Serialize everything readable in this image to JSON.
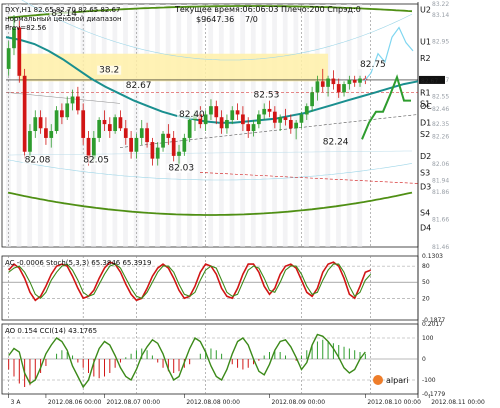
{
  "header": {
    "symbol_line": "DXY,H1  82.65 82.70 82.65 82.67",
    "server_time": "Текущее время:06:06:03 Плечо:200 Спрэд:0",
    "account_value": "$9647.36",
    "ratio": "7/0",
    "corner_value": "83.14",
    "indicator_name": "нормальный ценовой диапазон",
    "indicator_sub": "Prev=82.56"
  },
  "colors": {
    "bull_candle": "#2e9c2e",
    "bear_candle": "#d11515",
    "teal_line": "#1a8f8f",
    "envelope": "#4f8f14",
    "forecast": "#7fd6f0",
    "pivot_bg": "#fff0a8",
    "stoch_main": "#d11515",
    "stoch_signal": "#3c8a1a",
    "cci": "#3c8a1a",
    "ao_bar": "#d11515"
  },
  "chart_data": [
    {
      "type": "candlestick",
      "title": "DXY,H1",
      "ylim": [
        81.46,
        83.22
      ],
      "y_ticks": [
        {
          "v": 83.22,
          "l": "83.22"
        },
        {
          "v": 83.14,
          "l": "83.14"
        },
        {
          "v": 82.95,
          "l": "82.95"
        },
        {
          "v": 82.67,
          "l": "82.67"
        },
        {
          "v": 82.55,
          "l": "82.55"
        },
        {
          "v": 82.46,
          "l": "82.46"
        },
        {
          "v": 82.35,
          "l": "82.35"
        },
        {
          "v": 82.26,
          "l": "82.26"
        },
        {
          "v": 82.06,
          "l": "82.06"
        },
        {
          "v": 81.94,
          "l": "81.94"
        },
        {
          "v": 81.86,
          "l": "81.86"
        },
        {
          "v": 81.66,
          "l": "81.66"
        },
        {
          "v": 81.46,
          "l": "81.46"
        }
      ],
      "price_labels": [
        {
          "t": "83.14",
          "x": 8,
          "v": 83.14
        },
        {
          "t": "38.2",
          "x": 17,
          "v": 82.73
        },
        {
          "t": "82.67",
          "x": 22,
          "v": 82.62
        },
        {
          "t": "82.40",
          "x": 32,
          "v": 82.41
        },
        {
          "t": "82.53",
          "x": 46,
          "v": 82.55
        },
        {
          "t": "82.75",
          "x": 66,
          "v": 82.77
        },
        {
          "t": "82.24",
          "x": 59,
          "v": 82.21
        },
        {
          "t": "82.08",
          "x": 3,
          "v": 82.08
        },
        {
          "t": "82.05",
          "x": 14,
          "v": 82.08
        },
        {
          "t": "82.03",
          "x": 30,
          "v": 82.02
        }
      ],
      "levels": [
        {
          "name": "U2",
          "v": 83.18
        },
        {
          "name": "U1",
          "v": 82.95
        },
        {
          "name": "R2",
          "v": 82.83
        },
        {
          "name": "LB",
          "v": 82.67
        },
        {
          "name": "R1",
          "v": 82.58
        },
        {
          "name": "S1",
          "v": 82.5
        },
        {
          "name": "OC",
          "v": 82.48
        },
        {
          "name": "D1",
          "v": 82.36
        },
        {
          "name": "S2",
          "v": 82.28
        },
        {
          "name": "D2",
          "v": 82.12
        },
        {
          "name": "S3",
          "v": 82.0
        },
        {
          "name": "D3",
          "v": 81.9
        },
        {
          "name": "S4",
          "v": 81.71
        },
        {
          "name": "D4",
          "v": 81.6
        }
      ],
      "session_markers": [
        0,
        14,
        24,
        37,
        55,
        68
      ],
      "x_ticks": [
        {
          "x": 0,
          "l": "3 A"
        },
        {
          "x": 7,
          "l": "2012.08.06 00:00"
        },
        {
          "x": 18,
          "l": "2012.08.07 00:00"
        },
        {
          "x": 33,
          "l": "2012.08.08 00:00"
        },
        {
          "x": 49,
          "l": "2012.08.09 00:00"
        },
        {
          "x": 67,
          "l": "2012.08.10 00:00"
        },
        {
          "x": 79,
          "l": "2012.08.11 00:00"
        }
      ],
      "candles": [
        [
          82.75,
          82.95,
          82.7,
          82.9
        ],
        [
          82.9,
          83.14,
          82.85,
          83.05
        ],
        [
          83.05,
          83.1,
          82.65,
          82.7
        ],
        [
          82.7,
          82.75,
          82.1,
          82.15
        ],
        [
          82.15,
          82.35,
          82.08,
          82.3
        ],
        [
          82.3,
          82.45,
          82.25,
          82.4
        ],
        [
          82.4,
          82.45,
          82.28,
          82.32
        ],
        [
          82.32,
          82.4,
          82.2,
          82.25
        ],
        [
          82.25,
          82.35,
          82.18,
          82.3
        ],
        [
          82.3,
          82.48,
          82.28,
          82.45
        ],
        [
          82.45,
          82.5,
          82.35,
          82.4
        ],
        [
          82.4,
          82.55,
          82.38,
          82.5
        ],
        [
          82.5,
          82.6,
          82.45,
          82.55
        ],
        [
          82.55,
          82.62,
          82.42,
          82.45
        ],
        [
          82.45,
          82.5,
          82.2,
          82.25
        ],
        [
          82.25,
          82.3,
          82.05,
          82.1
        ],
        [
          82.1,
          82.3,
          82.08,
          82.25
        ],
        [
          82.25,
          82.4,
          82.22,
          82.38
        ],
        [
          82.38,
          82.45,
          82.3,
          82.35
        ],
        [
          82.35,
          82.4,
          82.25,
          82.3
        ],
        [
          82.3,
          82.42,
          82.28,
          82.4
        ],
        [
          82.4,
          82.45,
          82.3,
          82.32
        ],
        [
          82.32,
          82.38,
          82.2,
          82.25
        ],
        [
          82.25,
          82.3,
          82.1,
          82.15
        ],
        [
          82.15,
          82.28,
          82.1,
          82.25
        ],
        [
          82.25,
          82.38,
          82.2,
          82.32
        ],
        [
          82.32,
          82.36,
          82.18,
          82.22
        ],
        [
          82.22,
          82.25,
          82.05,
          82.1
        ],
        [
          82.1,
          82.22,
          82.05,
          82.18
        ],
        [
          82.18,
          82.3,
          82.15,
          82.28
        ],
        [
          82.28,
          82.35,
          82.2,
          82.25
        ],
        [
          82.25,
          82.3,
          82.08,
          82.12
        ],
        [
          82.12,
          82.2,
          82.03,
          82.15
        ],
        [
          82.15,
          82.28,
          82.12,
          82.25
        ],
        [
          82.25,
          82.4,
          82.22,
          82.38
        ],
        [
          82.38,
          82.45,
          82.3,
          82.42
        ],
        [
          82.42,
          82.48,
          82.32,
          82.35
        ],
        [
          82.35,
          82.45,
          82.3,
          82.42
        ],
        [
          82.42,
          82.53,
          82.38,
          82.48
        ],
        [
          82.48,
          82.52,
          82.35,
          82.4
        ],
        [
          82.4,
          82.45,
          82.28,
          82.32
        ],
        [
          82.32,
          82.42,
          82.28,
          82.38
        ],
        [
          82.38,
          82.48,
          82.35,
          82.45
        ],
        [
          82.45,
          82.5,
          82.38,
          82.42
        ],
        [
          82.42,
          82.48,
          82.3,
          82.35
        ],
        [
          82.35,
          82.4,
          82.25,
          82.3
        ],
        [
          82.3,
          82.38,
          82.26,
          82.35
        ],
        [
          82.35,
          82.45,
          82.32,
          82.42
        ],
        [
          82.42,
          82.5,
          82.38,
          82.46
        ],
        [
          82.46,
          82.52,
          82.4,
          82.44
        ],
        [
          82.44,
          82.48,
          82.32,
          82.36
        ],
        [
          82.36,
          82.42,
          82.3,
          82.4
        ],
        [
          82.4,
          82.46,
          82.34,
          82.38
        ],
        [
          82.38,
          82.42,
          82.28,
          82.32
        ],
        [
          82.32,
          82.38,
          82.24,
          82.36
        ],
        [
          82.36,
          82.44,
          82.32,
          82.42
        ],
        [
          82.42,
          82.5,
          82.38,
          82.48
        ],
        [
          82.48,
          82.62,
          82.44,
          82.58
        ],
        [
          82.58,
          82.7,
          82.52,
          82.66
        ],
        [
          82.66,
          82.75,
          82.58,
          82.62
        ],
        [
          82.62,
          82.7,
          82.55,
          82.68
        ],
        [
          82.68,
          82.74,
          82.6,
          82.64
        ],
        [
          82.64,
          82.68,
          82.54,
          82.58
        ],
        [
          82.58,
          82.66,
          82.55,
          82.64
        ],
        [
          82.64,
          82.7,
          82.6,
          82.67
        ],
        [
          82.67,
          82.7,
          82.62,
          82.65
        ],
        [
          82.65,
          82.7,
          82.62,
          82.68
        ],
        [
          82.68,
          82.7,
          82.64,
          82.67
        ]
      ],
      "teal_ma": [
        82.98,
        82.96,
        82.93,
        82.88,
        82.82,
        82.75,
        82.68,
        82.62,
        82.57,
        82.52,
        82.48,
        82.44,
        82.41,
        82.39,
        82.37,
        82.36,
        82.36,
        82.37,
        82.38,
        82.39,
        82.41,
        82.43,
        82.46,
        82.49,
        82.52,
        82.55,
        82.58,
        82.61,
        82.64,
        82.66
      ],
      "forecast": [
        82.66,
        82.72,
        82.86,
        82.8,
        82.98,
        83.05,
        82.94,
        82.88
      ]
    },
    {
      "type": "line",
      "title": "AC -0.0006 Stoch(5,3,3) 65.3846 65.3919",
      "ylim": [
        -0.1877,
        0.1303
      ],
      "y_ticks": [
        {
          "v": 0.1303,
          "l": "0.1303"
        },
        {
          "v": 0.08,
          "l": "80"
        },
        {
          "v": 0.0,
          "l": "50"
        },
        {
          "v": -0.08,
          "l": "20"
        },
        {
          "v": -0.1877,
          "l": "-0.1877"
        }
      ],
      "series": [
        {
          "name": "Stoch(5,3,3)",
          "values": [
            0.06,
            0.09,
            0.07,
            0.02,
            -0.05,
            -0.09,
            -0.07,
            -0.02,
            0.04,
            0.08,
            0.09,
            0.08,
            0.03,
            -0.03,
            -0.08,
            -0.07,
            -0.04,
            0.02,
            0.07,
            0.1,
            0.09,
            0.05,
            -0.01,
            -0.06,
            -0.09,
            -0.08,
            -0.03,
            0.03,
            0.07,
            0.09,
            0.07,
            0.02,
            -0.04,
            -0.08,
            -0.07,
            -0.02,
            0.05,
            0.09,
            0.08,
            0.04,
            -0.03,
            -0.07,
            -0.08,
            -0.03,
            0.04,
            0.09,
            0.09,
            0.05,
            -0.02,
            -0.06,
            -0.03,
            0.04,
            0.08,
            0.09,
            0.07,
            0.01,
            -0.05,
            -0.07,
            -0.03,
            0.05,
            0.09,
            0.1,
            0.08,
            0.02,
            -0.06,
            -0.08,
            -0.02,
            0.05,
            0.06
          ]
        },
        {
          "name": "Signal",
          "values": [
            0.05,
            0.07,
            0.08,
            0.05,
            0.0,
            -0.06,
            -0.08,
            -0.05,
            0.01,
            0.05,
            0.08,
            0.09,
            0.06,
            0.01,
            -0.05,
            -0.07,
            -0.06,
            -0.01,
            0.04,
            0.08,
            0.09,
            0.07,
            0.02,
            -0.03,
            -0.07,
            -0.08,
            -0.05,
            0.0,
            0.05,
            0.08,
            0.08,
            0.05,
            -0.01,
            -0.06,
            -0.07,
            -0.05,
            0.01,
            0.06,
            0.08,
            0.07,
            0.01,
            -0.05,
            -0.07,
            -0.06,
            0.0,
            0.06,
            0.08,
            0.07,
            0.02,
            -0.04,
            -0.05,
            0.0,
            0.06,
            0.08,
            0.08,
            0.04,
            -0.02,
            -0.06,
            -0.05,
            0.01,
            0.06,
            0.09,
            0.09,
            0.05,
            -0.02,
            -0.07,
            -0.05,
            0.01,
            0.04
          ]
        }
      ]
    },
    {
      "type": "bar+line",
      "title": "AO 0.154 CCI(14) 43.1765",
      "ylim": [
        -0.2,
        0.2
      ],
      "y_ticks": [
        {
          "v": 0.2,
          "l": "0.2017"
        },
        {
          "v": 0.12,
          "l": "100"
        },
        {
          "v": 0.0,
          "l": "0"
        },
        {
          "v": -0.12,
          "l": "-100"
        },
        {
          "v": -0.2,
          "l": "-0.1779"
        }
      ],
      "ao_bars": [
        -0.06,
        -0.1,
        -0.14,
        -0.16,
        -0.15,
        -0.12,
        -0.08,
        -0.04,
        0.0,
        0.03,
        0.05,
        0.04,
        0.02,
        -0.02,
        -0.05,
        -0.08,
        -0.1,
        -0.11,
        -0.1,
        -0.08,
        -0.05,
        -0.02,
        0.01,
        0.03,
        0.05,
        0.06,
        0.05,
        0.02,
        -0.02,
        -0.05,
        -0.07,
        -0.08,
        -0.07,
        -0.05,
        -0.03,
        0.0,
        0.03,
        0.05,
        0.06,
        0.05,
        0.03,
        0.0,
        -0.03,
        -0.05,
        -0.06,
        -0.05,
        -0.03,
        -0.01,
        0.02,
        0.04,
        0.05,
        0.04,
        0.02,
        0.0,
        -0.01,
        0.02,
        0.05,
        0.08,
        0.1,
        0.11,
        0.1,
        0.09,
        0.08,
        0.07,
        0.06,
        0.05,
        0.04,
        0.03
      ],
      "series": [
        {
          "name": "CCI(14)",
          "values": [
            0.02,
            0.06,
            0.04,
            -0.08,
            -0.14,
            -0.12,
            -0.05,
            0.03,
            0.08,
            0.12,
            0.1,
            0.05,
            -0.04,
            -0.1,
            -0.16,
            -0.12,
            -0.02,
            0.06,
            0.1,
            0.08,
            0.02,
            -0.05,
            -0.1,
            -0.12,
            -0.06,
            0.02,
            0.07,
            0.11,
            0.09,
            0.03,
            -0.06,
            -0.12,
            -0.1,
            -0.02,
            0.06,
            0.12,
            0.1,
            0.04,
            -0.04,
            -0.1,
            -0.12,
            -0.06,
            0.03,
            0.1,
            0.12,
            0.08,
            0.0,
            -0.07,
            -0.09,
            -0.03,
            0.05,
            0.1,
            0.11,
            0.07,
            0.01,
            -0.06,
            -0.02,
            0.08,
            0.14,
            0.13,
            0.1,
            0.06,
            0.01,
            -0.05,
            -0.08,
            -0.06,
            0.0,
            0.04
          ]
        }
      ]
    }
  ],
  "watermark": "alpari"
}
